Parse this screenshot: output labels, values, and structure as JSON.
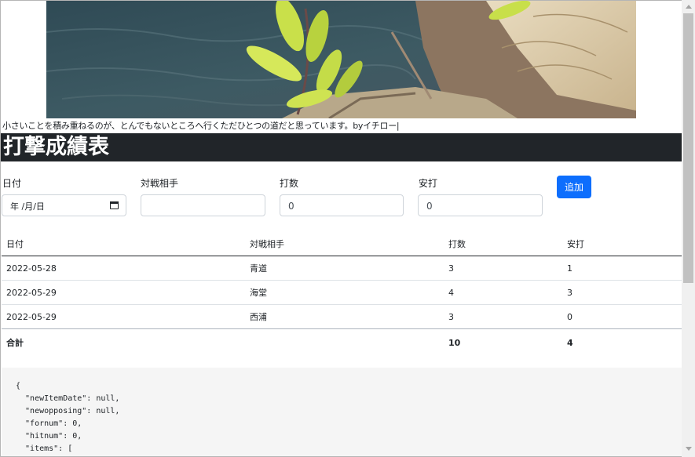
{
  "quote": "小さいことを積み重ねるのが、とんでもないところへ行くただひとつの道だと思っています。byイチロー|",
  "title": "打撃成績表",
  "form": {
    "date_label": "日付",
    "date_placeholder": "年 /月/日",
    "opponent_label": "対戦相手",
    "opponent_value": "",
    "atbats_label": "打数",
    "atbats_value": "0",
    "hits_label": "安打",
    "hits_value": "0",
    "add_label": "追加"
  },
  "table": {
    "headers": [
      "日付",
      "対戦相手",
      "打数",
      "安打"
    ],
    "rows": [
      [
        "2022-05-28",
        "青道",
        "3",
        "1"
      ],
      [
        "2022-05-29",
        "海堂",
        "4",
        "3"
      ],
      [
        "2022-05-29",
        "西浦",
        "3",
        "0"
      ]
    ],
    "total": [
      "合計",
      "",
      "10",
      "4"
    ]
  },
  "json_preview": "{\n  \"newItemDate\": null,\n  \"newopposing\": null,\n  \"fornum\": 0,\n  \"hitnum\": 0,\n  \"items\": [\n    {",
  "colors": {
    "accent": "#0d6efd",
    "titlebar": "#212529"
  }
}
